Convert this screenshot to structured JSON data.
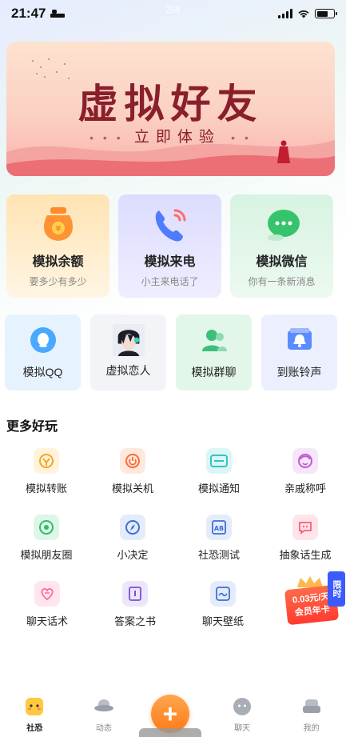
{
  "status_bar": {
    "time": "21:47",
    "page_indicator": "2/4"
  },
  "banner": {
    "title": "虚拟好友",
    "subtitle": "立即体验",
    "subtitle_dots_left": "• • •",
    "subtitle_dots_right": "• •"
  },
  "big_cards": [
    {
      "title": "模拟余额",
      "subtitle": "要多少有多少",
      "icon": "money-bag-icon"
    },
    {
      "title": "模拟来电",
      "subtitle": "小主来电话了",
      "icon": "phone-call-icon"
    },
    {
      "title": "模拟微信",
      "subtitle": "你有一条新消息",
      "icon": "wechat-icon"
    }
  ],
  "small_cards": [
    {
      "label": "模拟QQ",
      "icon": "qq-penguin-icon"
    },
    {
      "label": "虚拟恋人",
      "icon": "anime-avatar-icon"
    },
    {
      "label": "模拟群聊",
      "icon": "group-chat-icon"
    },
    {
      "label": "到账铃声",
      "icon": "bell-notification-icon"
    }
  ],
  "more_section": {
    "title": "更多好玩",
    "rows": [
      [
        {
          "label": "模拟转账",
          "icon": "transfer-icon",
          "color": "#f5a623"
        },
        {
          "label": "模拟关机",
          "icon": "power-icon",
          "color": "#ff6b35"
        },
        {
          "label": "模拟通知",
          "icon": "notification-card-icon",
          "color": "#2fc5c5"
        },
        {
          "label": "亲戚称呼",
          "icon": "relative-face-icon",
          "color": "#c15bd6"
        }
      ],
      [
        {
          "label": "模拟朋友圈",
          "icon": "moments-icon",
          "color": "#2dbd6e"
        },
        {
          "label": "小决定",
          "icon": "compass-icon",
          "color": "#3d6fd6"
        },
        {
          "label": "社恐测试",
          "icon": "test-ab-icon",
          "color": "#3d6fd6"
        },
        {
          "label": "抽象话生成",
          "icon": "chat-bubble-face-icon",
          "color": "#ff5a7a"
        }
      ],
      [
        {
          "label": "聊天话术",
          "icon": "heart-chat-icon",
          "color": "#ff6b8f"
        },
        {
          "label": "答案之书",
          "icon": "book-icon",
          "color": "#7a4fd6"
        },
        {
          "label": "聊天壁纸",
          "icon": "wallpaper-icon",
          "color": "#3d6fd6"
        }
      ]
    ]
  },
  "promo": {
    "price_line": "0.03元/天",
    "card_line": "会员年卡",
    "tag": "限时"
  },
  "tabbar": [
    {
      "label": "社恐",
      "icon": "shy-face-icon",
      "active": true
    },
    {
      "label": "动态",
      "icon": "ufo-icon",
      "active": false
    },
    {
      "label": "",
      "icon": "plus-icon",
      "active": false
    },
    {
      "label": "聊天",
      "icon": "chat-face-icon",
      "active": false
    },
    {
      "label": "我的",
      "icon": "profile-sofa-icon",
      "active": false
    }
  ],
  "colors": {
    "accent_orange": "#ff7a1a",
    "banner_text": "#8a1f2c",
    "promo_red": "#ff3b30",
    "promo_blue": "#3b5bff"
  }
}
